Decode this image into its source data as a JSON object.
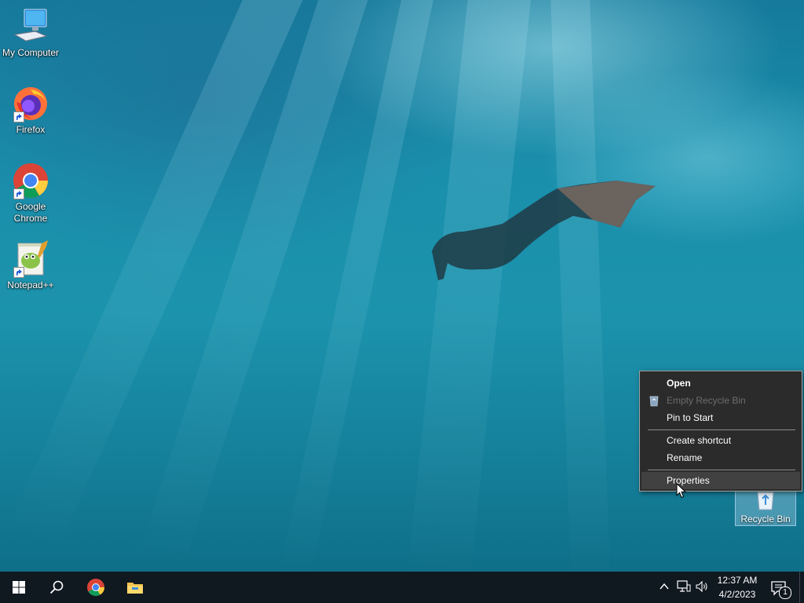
{
  "desktop": {
    "icons": [
      {
        "name": "my-computer",
        "label": "My Computer"
      },
      {
        "name": "firefox",
        "label": "Firefox"
      },
      {
        "name": "google-chrome",
        "label": "Google Chrome"
      },
      {
        "name": "notepad-plus-plus",
        "label": "Notepad++"
      }
    ],
    "recycle_bin": {
      "label": "Recycle Bin"
    }
  },
  "context_menu": {
    "items": [
      {
        "label": "Open",
        "bold": true,
        "enabled": true
      },
      {
        "label": "Empty Recycle Bin",
        "enabled": false,
        "icon": "recycle-bin-icon"
      },
      {
        "label": "Pin to Start",
        "enabled": true
      },
      {
        "label": "Create shortcut",
        "enabled": true
      },
      {
        "label": "Rename",
        "enabled": true
      },
      {
        "label": "Properties",
        "enabled": true,
        "hovered": true
      }
    ]
  },
  "taskbar": {
    "pinned": [
      "windows-start-icon",
      "search-icon",
      "chrome-icon",
      "file-explorer-icon"
    ],
    "tray": [
      "chevron-up-icon",
      "network-icon",
      "volume-icon"
    ],
    "clock": {
      "time": "12:37 AM",
      "date": "4/2/2023"
    },
    "notifications": {
      "count": "1"
    }
  },
  "colors": {
    "menu_bg": "#2b2b2b",
    "menu_hover": "#414141",
    "taskbar_bg": "#101820",
    "desktop_water": "#1a8fac"
  }
}
